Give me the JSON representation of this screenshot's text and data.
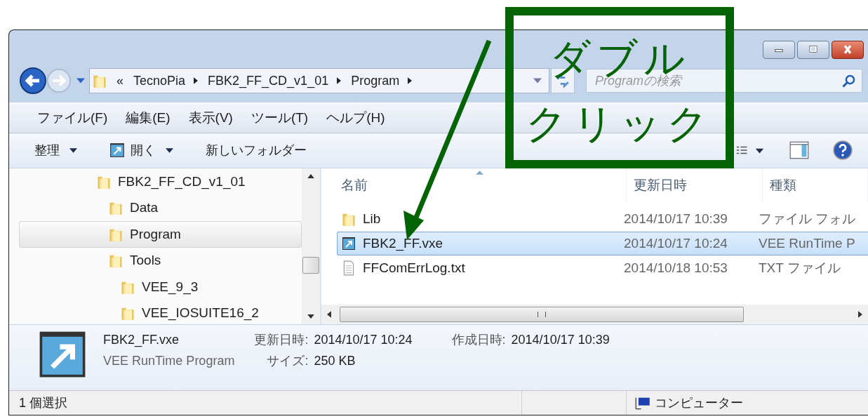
{
  "address_bar": {
    "overflow_marker": "«",
    "crumbs": [
      "TecnoPia",
      "FBK2_FF_CD_v1_01",
      "Program"
    ]
  },
  "search": {
    "placeholder": "Programの検索"
  },
  "menu": [
    "ファイル(F)",
    "編集(E)",
    "表示(V)",
    "ツール(T)",
    "ヘルプ(H)"
  ],
  "toolbar": [
    {
      "label": "整理",
      "kind": "menu"
    },
    {
      "label": "開く",
      "kind": "open"
    },
    {
      "label": "新しいフォルダー",
      "kind": "plain"
    }
  ],
  "tree": [
    {
      "label": "FBK2_FF_CD_v1_01",
      "selected": false,
      "children": [
        {
          "label": "Data",
          "selected": false
        },
        {
          "label": "Program",
          "selected": true
        },
        {
          "label": "Tools",
          "selected": false,
          "children": [
            {
              "label": "VEE_9_3",
              "selected": false
            },
            {
              "label": "VEE_IOSUITE16_2",
              "selected": false
            }
          ]
        }
      ]
    }
  ],
  "columns": [
    {
      "label": "名前",
      "sorted": true
    },
    {
      "label": "更新日時",
      "sorted": false
    },
    {
      "label": "種類",
      "sorted": false
    }
  ],
  "rows": [
    {
      "name": "Lib",
      "modified": "2014/10/17 10:39",
      "type": "ファイル フォル",
      "kind": "folder",
      "selected": false
    },
    {
      "name": "FBK2_FF.vxe",
      "modified": "2014/10/17 10:24",
      "type": "VEE RunTime P",
      "kind": "program",
      "selected": true
    },
    {
      "name": "FFComErrLog.txt",
      "modified": "2014/10/18 10:53",
      "type": "TXT ファイル",
      "kind": "text",
      "selected": false
    }
  ],
  "details": {
    "name": "FBK2_FF.vxe",
    "type": "VEE RunTime Program",
    "properties": [
      {
        "label": "更新日時:",
        "value": "2014/10/17 10:24"
      },
      {
        "label": "作成日時:",
        "value": "2014/10/17 10:39"
      },
      {
        "label": "サイズ:",
        "value": "250 KB"
      }
    ]
  },
  "status_bar": {
    "selection": "1 個選択",
    "location": "コンピューター"
  },
  "annotation": {
    "lines": [
      "ダブル",
      "クリック"
    ]
  }
}
